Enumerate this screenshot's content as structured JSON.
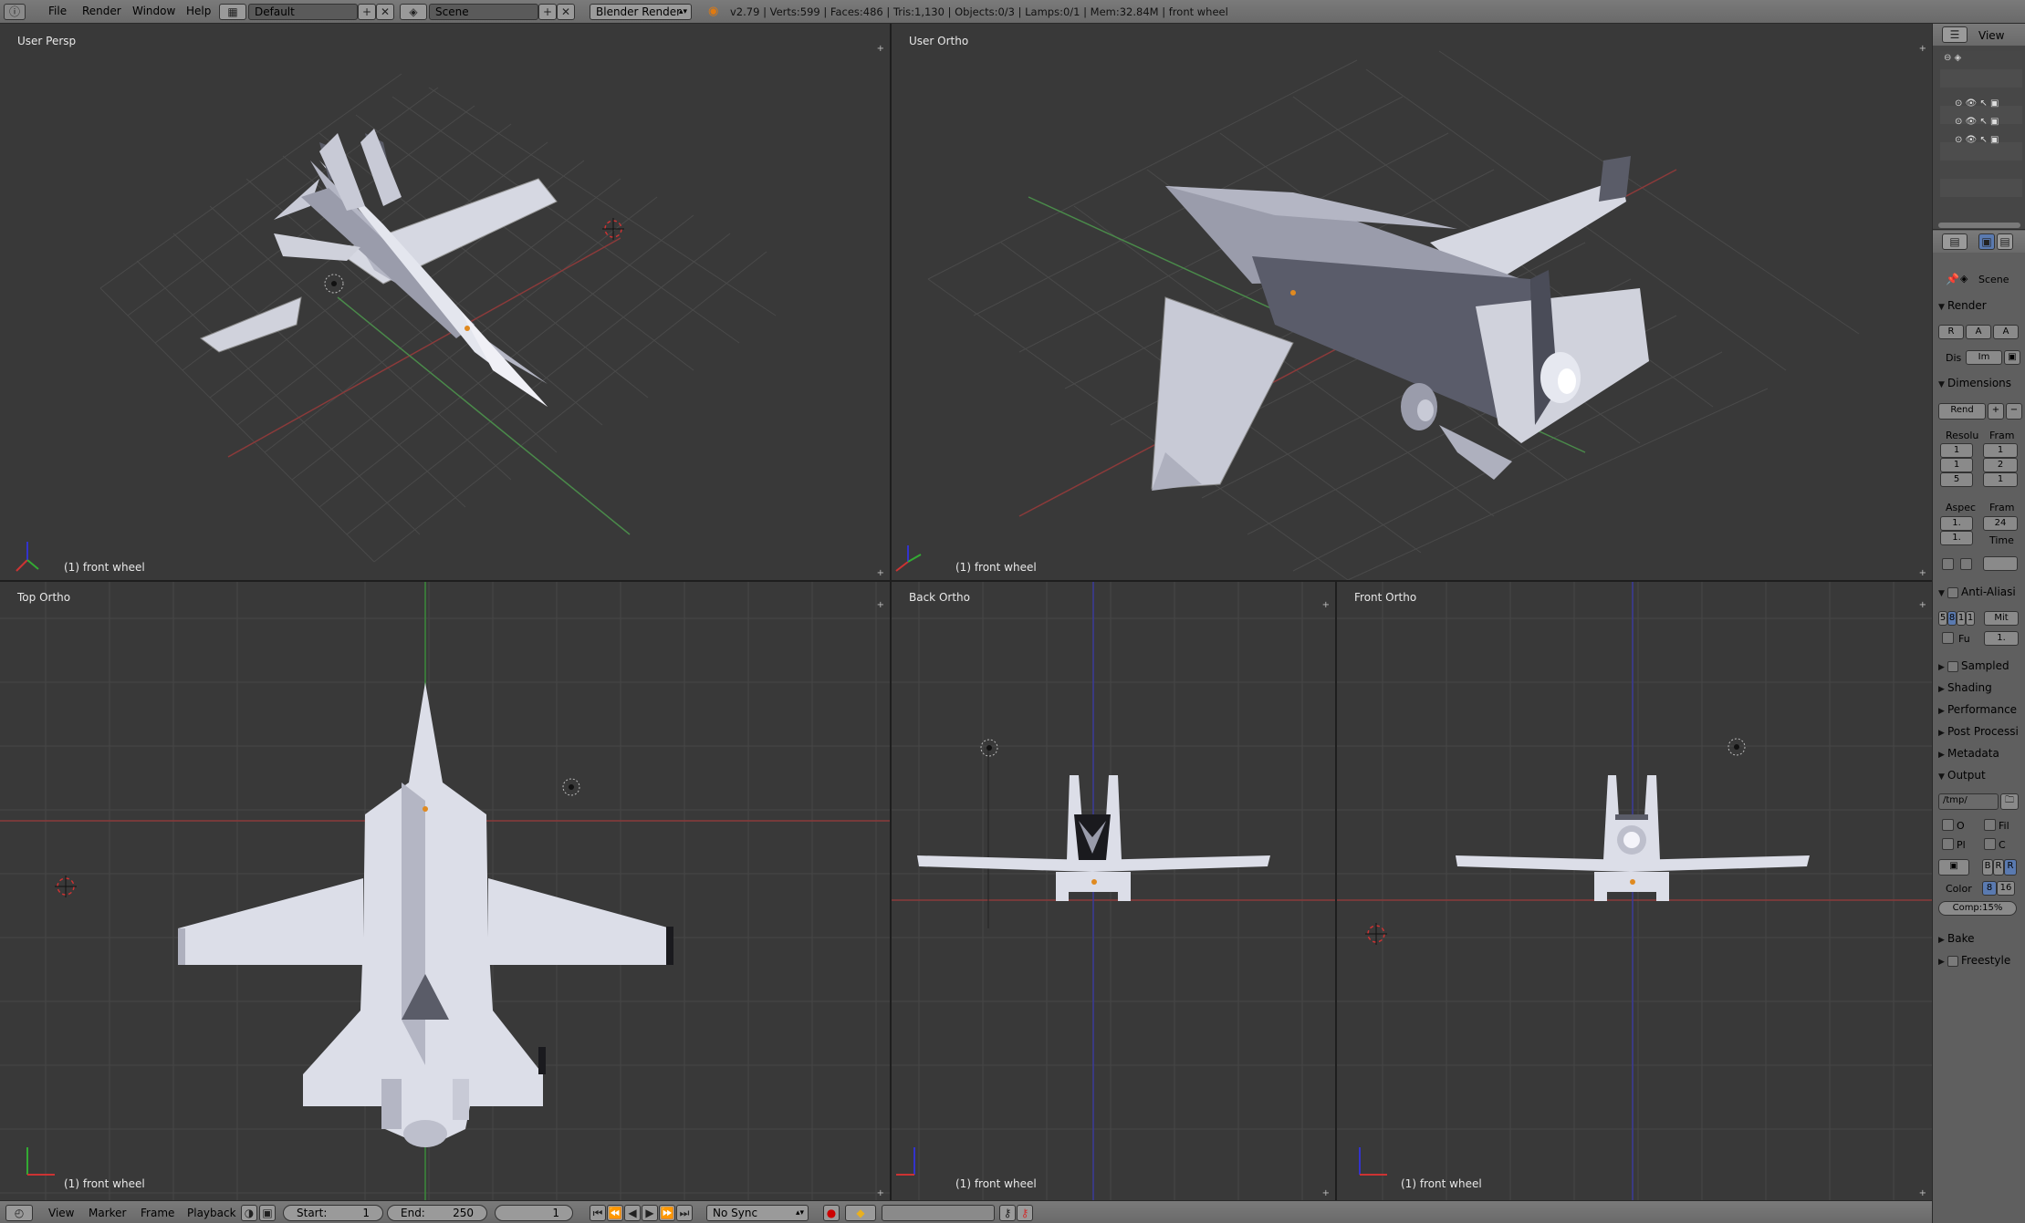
{
  "topbar": {
    "menus": [
      "File",
      "Render",
      "Window",
      "Help"
    ],
    "screen_layout": "Default",
    "scene": "Scene",
    "engine": "Blender Render",
    "stats": "v2.79 | Verts:599 | Faces:486 | Tris:1,130 | Objects:0/3 | Lamps:0/1 | Mem:32.84M | front wheel"
  },
  "viewports": [
    {
      "label": "User Persp",
      "object": "(1) front wheel"
    },
    {
      "label": "User Ortho",
      "object": "(1) front wheel"
    },
    {
      "label": "Top Ortho",
      "object": "(1) front wheel"
    },
    {
      "label": "Back Ortho",
      "object": "(1) front wheel"
    },
    {
      "label": "Front Ortho",
      "object": "(1) front wheel"
    }
  ],
  "bottombar": {
    "menus": [
      "View",
      "Marker",
      "Frame",
      "Playback"
    ],
    "start_label": "Start:",
    "start": "1",
    "end_label": "End:",
    "end": "250",
    "current_frame": "1",
    "sync": "No Sync"
  },
  "outliner": {
    "view_label": "View"
  },
  "properties": {
    "context": "Scene",
    "sections": {
      "render": "Render",
      "dimensions": "Dimensions",
      "anti_aliasing": "Anti-Aliasi",
      "sampled": "Sampled",
      "shading": "Shading",
      "performance": "Performance",
      "post_processing": "Post Processi",
      "metadata": "Metadata",
      "output": "Output",
      "bake": "Bake",
      "freestyle": "Freestyle"
    },
    "render_buttons": [
      "R",
      "A",
      "A"
    ],
    "display_label": "Dis",
    "display_value": "Im",
    "preset": "Rend",
    "resolution_label": "Resolu",
    "frame_label": "Fram",
    "res_values": [
      "1",
      "1",
      "5"
    ],
    "frame_values": [
      "1",
      "2",
      "1"
    ],
    "aspect_label": "Aspec",
    "fps_label": "Fram",
    "fps": "24",
    "aspect_values": [
      "1.",
      "1."
    ],
    "time_label": "Time",
    "aa_samples": [
      "5",
      "8",
      "1",
      "1"
    ],
    "aa_filter": "Mit",
    "full_label": "Fu",
    "filter_size": "1.",
    "output_path": "/tmp/",
    "out_opts": [
      "O",
      "Fil",
      "Pl",
      "C"
    ],
    "color_label": "Color",
    "color_modes": [
      "B",
      "R",
      "R"
    ],
    "depth": [
      "8",
      "16"
    ],
    "compression": "Comp:15%"
  }
}
